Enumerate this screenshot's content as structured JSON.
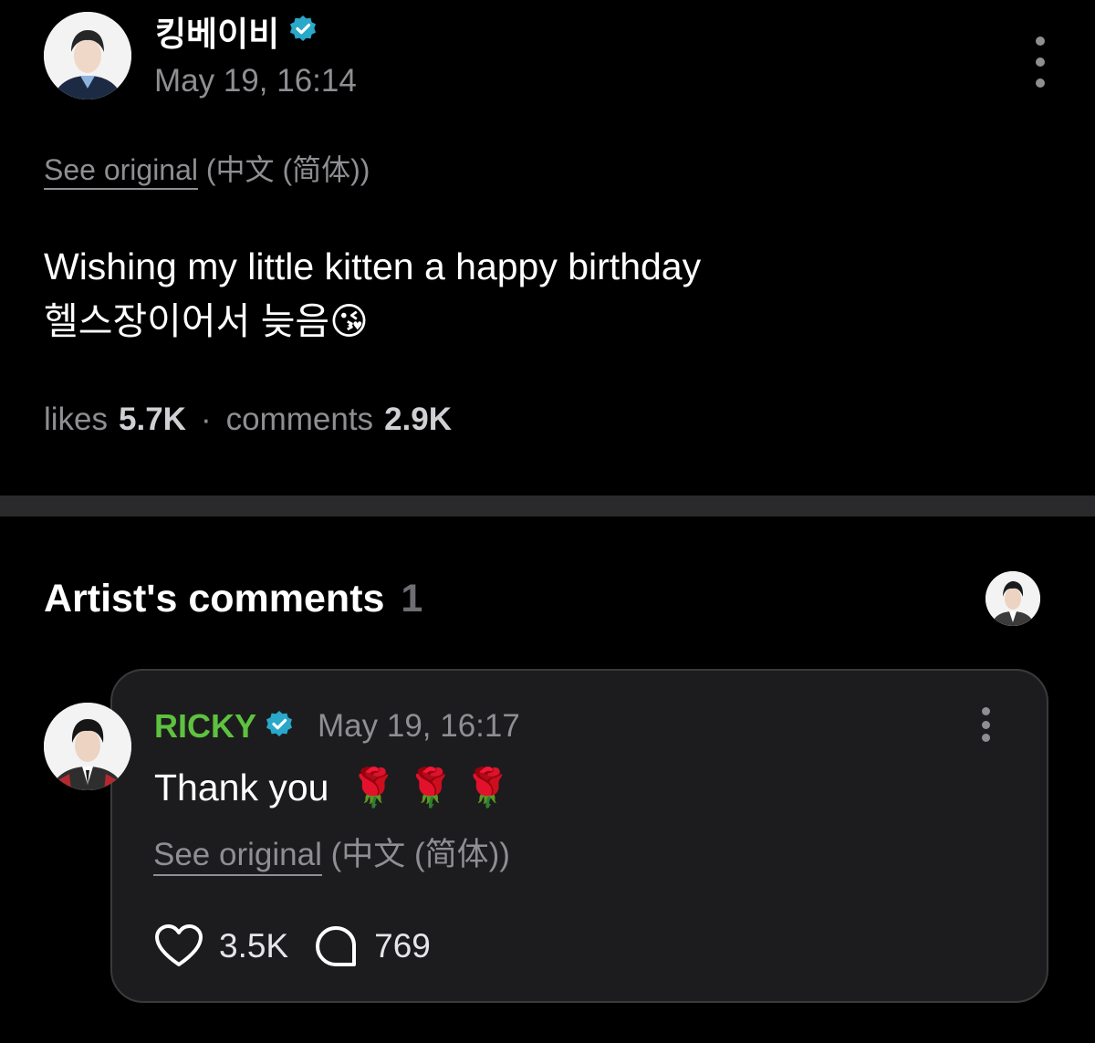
{
  "post": {
    "author_name": "킹베이비",
    "timestamp": "May 19, 16:14",
    "see_original_label": "See original",
    "original_language": "(中文 (简体))",
    "text_line1": "Wishing my little kitten a happy birthday",
    "text_line2": "헬스장이어서 늦음",
    "text_emoji": "😘",
    "likes_label": "likes",
    "likes_count": "5.7K",
    "separator": "·",
    "comments_label": "comments",
    "comments_count": "2.9K"
  },
  "artist_comments": {
    "heading": "Artist's comments",
    "count": "1",
    "comment": {
      "author_name": "RICKY",
      "author_color": "#5ec13f",
      "timestamp": "May 19, 16:17",
      "text": "Thank you",
      "emojis": "🌹 🌹 🌹",
      "see_original_label": "See original",
      "original_language": "(中文 (简体))",
      "likes_count": "3.5K",
      "replies_count": "769"
    }
  },
  "icons": {
    "verified": "verified-badge-icon",
    "more": "more-vertical-icon",
    "like": "heart-outline-icon",
    "reply": "speech-bubble-outline-icon"
  },
  "colors": {
    "background": "#000000",
    "verified_badge": "#2aa8c9",
    "muted_text": "#8e8e93",
    "card_background": "#1c1c1e"
  }
}
